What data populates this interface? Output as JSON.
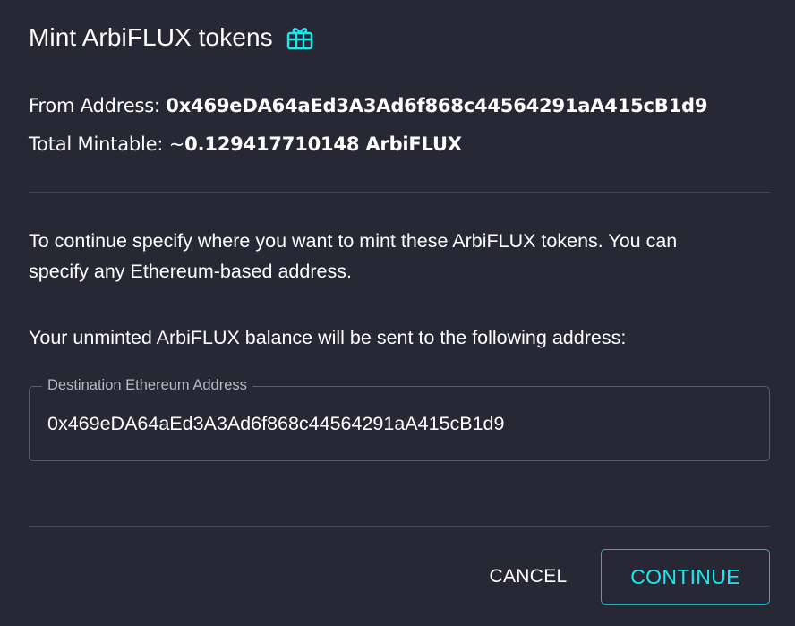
{
  "dialog": {
    "title": "Mint ArbiFLUX tokens",
    "title_icon": "gift-icon",
    "accent_color": "#1ee6f0"
  },
  "info": {
    "from_label": "From Address: ",
    "from_value": "0x469eDA64aEd3A3Ad6f868c44564291aA415cB1d9",
    "mintable_label": "Total Mintable: ~",
    "mintable_value": "0.129417710148 ArbiFLUX"
  },
  "body": {
    "paragraph_1_line_1": "To continue specify where you want to mint these ArbiFLUX tokens. You can",
    "paragraph_1_line_2": "specify any Ethereum-based address.",
    "paragraph_2": "Your unminted ArbiFLUX balance will be sent to the following address:"
  },
  "destination_field": {
    "label": "Destination Ethereum Address",
    "value": "0x469eDA64aEd3A3Ad6f868c44564291aA415cB1d9"
  },
  "actions": {
    "cancel_label": "CANCEL",
    "continue_label": "CONTINUE"
  }
}
